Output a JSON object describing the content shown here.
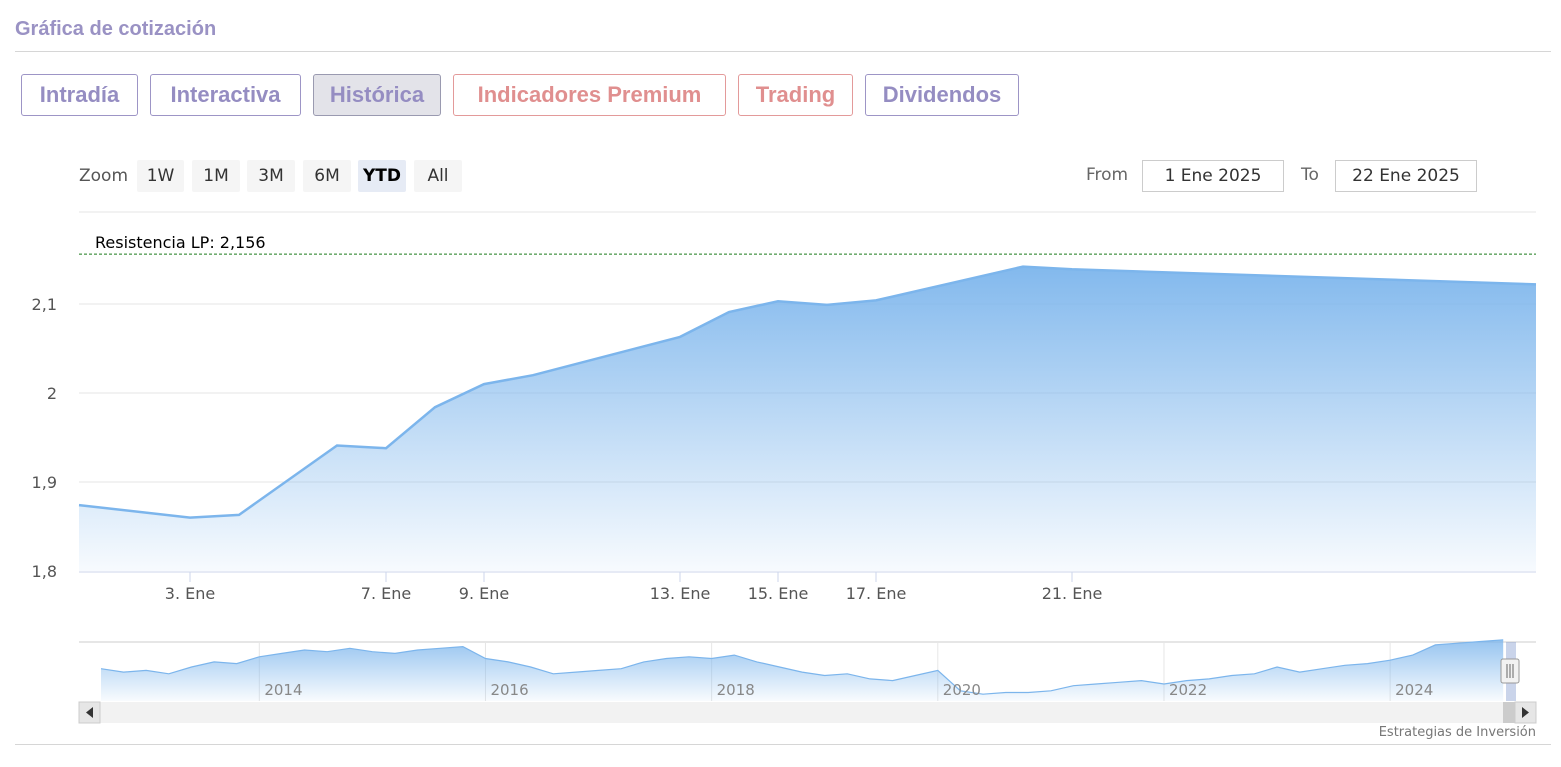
{
  "section_title": "Gráfica de cotización",
  "tabs": [
    {
      "label": "Intradía",
      "style": "normal"
    },
    {
      "label": "Interactiva",
      "style": "normal"
    },
    {
      "label": "Histórica",
      "style": "active"
    },
    {
      "label": "Indicadores Premium",
      "style": "premium"
    },
    {
      "label": "Trading",
      "style": "premium"
    },
    {
      "label": "Dividendos",
      "style": "normal"
    }
  ],
  "zoom": {
    "label": "Zoom",
    "buttons": [
      "1W",
      "1M",
      "3M",
      "6M",
      "YTD",
      "All"
    ],
    "active": "YTD"
  },
  "range": {
    "from_label": "From",
    "from_value": "1 Ene 2025",
    "to_label": "To",
    "to_value": "22 Ene 2025"
  },
  "credits": "Estrategias de Inversión",
  "colors": {
    "series": "#7cb5ec",
    "accent": "#958dc2",
    "premium": "#e08f8f",
    "resistance": "#1a7a1a"
  },
  "chart_data": {
    "type": "area",
    "x": [
      "2025-01-02",
      "2025-01-03",
      "2025-01-06",
      "2025-01-07",
      "2025-01-08",
      "2025-01-09",
      "2025-01-10",
      "2025-01-13",
      "2025-01-14",
      "2025-01-15",
      "2025-01-16",
      "2025-01-17",
      "2025-01-20",
      "2025-01-21",
      "2025-01-22"
    ],
    "values": [
      1.874,
      1.86,
      1.863,
      1.941,
      1.938,
      1.984,
      2.01,
      2.02,
      2.063,
      2.091,
      2.103,
      2.099,
      2.104,
      2.142,
      2.139,
      2.122
    ],
    "x_dates": [
      "2025-01-02",
      "2025-01-03",
      "2025-01-04",
      "2025-01-06",
      "2025-01-07",
      "2025-01-08",
      "2025-01-09",
      "2025-01-10",
      "2025-01-13",
      "2025-01-14",
      "2025-01-15",
      "2025-01-16",
      "2025-01-17",
      "2025-01-20",
      "2025-01-21",
      "2025-01-22"
    ],
    "ylim": [
      1.8,
      2.16
    ],
    "yticks": [
      "2,1",
      "2",
      "1,9",
      "1,8"
    ],
    "ytick_values": [
      2.1,
      2.0,
      1.9,
      1.8
    ],
    "xticks": [
      "3. Ene",
      "7. Ene",
      "9. Ene",
      "13. Ene",
      "15. Ene",
      "17. Ene",
      "21. Ene"
    ],
    "xtick_dates": [
      "2025-01-03",
      "2025-01-07",
      "2025-01-09",
      "2025-01-13",
      "2025-01-15",
      "2025-01-17",
      "2025-01-21"
    ],
    "grid": true,
    "resistance": {
      "label": "Resistencia LP: 2,156",
      "value": 2.156
    },
    "navigator": {
      "year_labels": [
        "2014",
        "2016",
        "2018",
        "2020",
        "2022",
        "2024"
      ],
      "years": [
        2014,
        2016,
        2018,
        2020,
        2022,
        2024
      ],
      "start_year": 2012.6,
      "end_year": 2025.06,
      "series": [
        [
          2012.6,
          1.78
        ],
        [
          2012.8,
          1.74
        ],
        [
          2013.0,
          1.76
        ],
        [
          2013.2,
          1.72
        ],
        [
          2013.4,
          1.8
        ],
        [
          2013.6,
          1.86
        ],
        [
          2013.8,
          1.84
        ],
        [
          2014.0,
          1.92
        ],
        [
          2014.2,
          1.96
        ],
        [
          2014.4,
          2.0
        ],
        [
          2014.6,
          1.98
        ],
        [
          2014.8,
          2.02
        ],
        [
          2015.0,
          1.98
        ],
        [
          2015.2,
          1.96
        ],
        [
          2015.4,
          2.0
        ],
        [
          2015.6,
          2.02
        ],
        [
          2015.8,
          2.04
        ],
        [
          2016.0,
          1.9
        ],
        [
          2016.2,
          1.86
        ],
        [
          2016.4,
          1.8
        ],
        [
          2016.6,
          1.72
        ],
        [
          2016.8,
          1.74
        ],
        [
          2017.0,
          1.76
        ],
        [
          2017.2,
          1.78
        ],
        [
          2017.4,
          1.86
        ],
        [
          2017.6,
          1.9
        ],
        [
          2017.8,
          1.92
        ],
        [
          2018.0,
          1.9
        ],
        [
          2018.2,
          1.94
        ],
        [
          2018.4,
          1.86
        ],
        [
          2018.6,
          1.8
        ],
        [
          2018.8,
          1.74
        ],
        [
          2019.0,
          1.7
        ],
        [
          2019.2,
          1.72
        ],
        [
          2019.4,
          1.66
        ],
        [
          2019.6,
          1.64
        ],
        [
          2019.8,
          1.7
        ],
        [
          2020.0,
          1.76
        ],
        [
          2020.2,
          1.52
        ],
        [
          2020.4,
          1.48
        ],
        [
          2020.6,
          1.5
        ],
        [
          2020.8,
          1.5
        ],
        [
          2021.0,
          1.52
        ],
        [
          2021.2,
          1.58
        ],
        [
          2021.4,
          1.6
        ],
        [
          2021.6,
          1.62
        ],
        [
          2021.8,
          1.64
        ],
        [
          2022.0,
          1.6
        ],
        [
          2022.2,
          1.64
        ],
        [
          2022.4,
          1.66
        ],
        [
          2022.6,
          1.7
        ],
        [
          2022.8,
          1.72
        ],
        [
          2023.0,
          1.8
        ],
        [
          2023.2,
          1.74
        ],
        [
          2023.4,
          1.78
        ],
        [
          2023.6,
          1.82
        ],
        [
          2023.8,
          1.84
        ],
        [
          2024.0,
          1.88
        ],
        [
          2024.2,
          1.94
        ],
        [
          2024.4,
          2.06
        ],
        [
          2024.6,
          2.08
        ],
        [
          2024.8,
          2.1
        ],
        [
          2025.0,
          2.12
        ]
      ]
    }
  }
}
